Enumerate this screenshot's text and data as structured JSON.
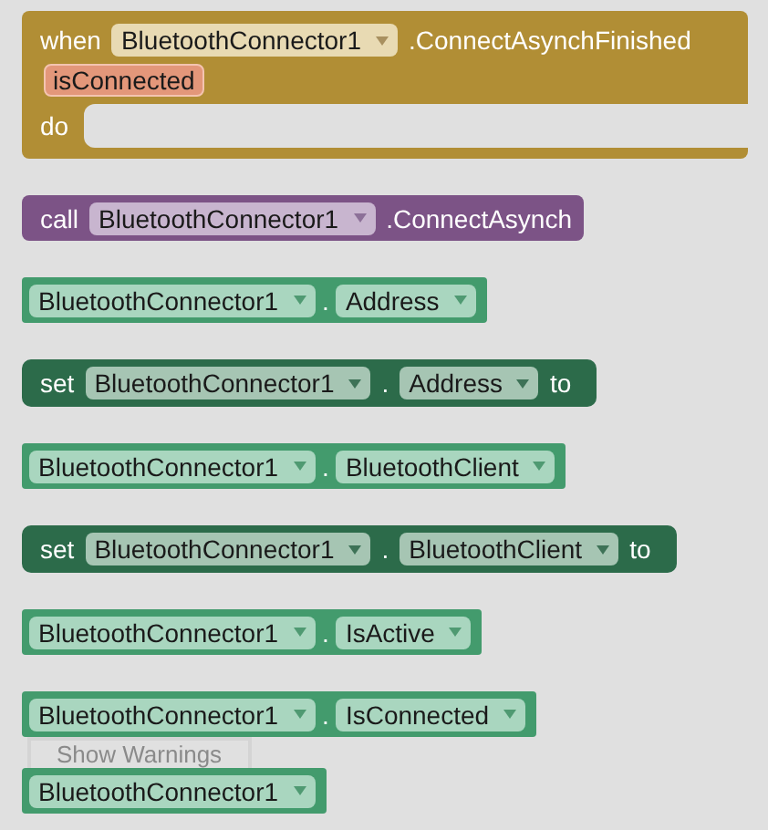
{
  "blocks": [
    {
      "kind": "event",
      "keyword": "when",
      "component": "BluetoothConnector1",
      "event": ".ConnectAsynchFinished",
      "params": [
        "isConnected"
      ],
      "do_label": "do"
    },
    {
      "kind": "method",
      "keyword": "call",
      "component": "BluetoothConnector1",
      "method": ".ConnectAsynch"
    },
    {
      "kind": "getter",
      "component": "BluetoothConnector1",
      "dot": ".",
      "property": "Address"
    },
    {
      "kind": "setter",
      "keyword": "set",
      "component": "BluetoothConnector1",
      "dot": ".",
      "property": "Address",
      "to_label": "to"
    },
    {
      "kind": "getter",
      "component": "BluetoothConnector1",
      "dot": ".",
      "property": "BluetoothClient"
    },
    {
      "kind": "setter",
      "keyword": "set",
      "component": "BluetoothConnector1",
      "dot": ".",
      "property": "BluetoothClient",
      "to_label": "to"
    },
    {
      "kind": "getter",
      "component": "BluetoothConnector1",
      "dot": ".",
      "property": "IsActive"
    },
    {
      "kind": "getter",
      "component": "BluetoothConnector1",
      "dot": ".",
      "property": "IsConnected"
    },
    {
      "kind": "button",
      "label": "Show Warnings"
    },
    {
      "kind": "component",
      "component": "BluetoothConnector1"
    }
  ]
}
